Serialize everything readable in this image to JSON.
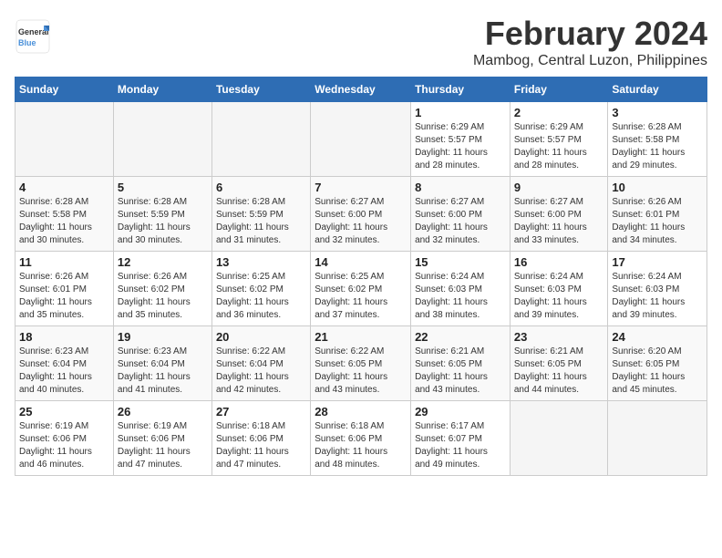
{
  "header": {
    "logo_general": "General",
    "logo_blue": "Blue",
    "month_year": "February 2024",
    "location": "Mambog, Central Luzon, Philippines"
  },
  "days_of_week": [
    "Sunday",
    "Monday",
    "Tuesday",
    "Wednesday",
    "Thursday",
    "Friday",
    "Saturday"
  ],
  "weeks": [
    [
      {
        "day": "",
        "info": ""
      },
      {
        "day": "",
        "info": ""
      },
      {
        "day": "",
        "info": ""
      },
      {
        "day": "",
        "info": ""
      },
      {
        "day": "1",
        "info": "Sunrise: 6:29 AM\nSunset: 5:57 PM\nDaylight: 11 hours\nand 28 minutes."
      },
      {
        "day": "2",
        "info": "Sunrise: 6:29 AM\nSunset: 5:57 PM\nDaylight: 11 hours\nand 28 minutes."
      },
      {
        "day": "3",
        "info": "Sunrise: 6:28 AM\nSunset: 5:58 PM\nDaylight: 11 hours\nand 29 minutes."
      }
    ],
    [
      {
        "day": "4",
        "info": "Sunrise: 6:28 AM\nSunset: 5:58 PM\nDaylight: 11 hours\nand 30 minutes."
      },
      {
        "day": "5",
        "info": "Sunrise: 6:28 AM\nSunset: 5:59 PM\nDaylight: 11 hours\nand 30 minutes."
      },
      {
        "day": "6",
        "info": "Sunrise: 6:28 AM\nSunset: 5:59 PM\nDaylight: 11 hours\nand 31 minutes."
      },
      {
        "day": "7",
        "info": "Sunrise: 6:27 AM\nSunset: 6:00 PM\nDaylight: 11 hours\nand 32 minutes."
      },
      {
        "day": "8",
        "info": "Sunrise: 6:27 AM\nSunset: 6:00 PM\nDaylight: 11 hours\nand 32 minutes."
      },
      {
        "day": "9",
        "info": "Sunrise: 6:27 AM\nSunset: 6:00 PM\nDaylight: 11 hours\nand 33 minutes."
      },
      {
        "day": "10",
        "info": "Sunrise: 6:26 AM\nSunset: 6:01 PM\nDaylight: 11 hours\nand 34 minutes."
      }
    ],
    [
      {
        "day": "11",
        "info": "Sunrise: 6:26 AM\nSunset: 6:01 PM\nDaylight: 11 hours\nand 35 minutes."
      },
      {
        "day": "12",
        "info": "Sunrise: 6:26 AM\nSunset: 6:02 PM\nDaylight: 11 hours\nand 35 minutes."
      },
      {
        "day": "13",
        "info": "Sunrise: 6:25 AM\nSunset: 6:02 PM\nDaylight: 11 hours\nand 36 minutes."
      },
      {
        "day": "14",
        "info": "Sunrise: 6:25 AM\nSunset: 6:02 PM\nDaylight: 11 hours\nand 37 minutes."
      },
      {
        "day": "15",
        "info": "Sunrise: 6:24 AM\nSunset: 6:03 PM\nDaylight: 11 hours\nand 38 minutes."
      },
      {
        "day": "16",
        "info": "Sunrise: 6:24 AM\nSunset: 6:03 PM\nDaylight: 11 hours\nand 39 minutes."
      },
      {
        "day": "17",
        "info": "Sunrise: 6:24 AM\nSunset: 6:03 PM\nDaylight: 11 hours\nand 39 minutes."
      }
    ],
    [
      {
        "day": "18",
        "info": "Sunrise: 6:23 AM\nSunset: 6:04 PM\nDaylight: 11 hours\nand 40 minutes."
      },
      {
        "day": "19",
        "info": "Sunrise: 6:23 AM\nSunset: 6:04 PM\nDaylight: 11 hours\nand 41 minutes."
      },
      {
        "day": "20",
        "info": "Sunrise: 6:22 AM\nSunset: 6:04 PM\nDaylight: 11 hours\nand 42 minutes."
      },
      {
        "day": "21",
        "info": "Sunrise: 6:22 AM\nSunset: 6:05 PM\nDaylight: 11 hours\nand 43 minutes."
      },
      {
        "day": "22",
        "info": "Sunrise: 6:21 AM\nSunset: 6:05 PM\nDaylight: 11 hours\nand 43 minutes."
      },
      {
        "day": "23",
        "info": "Sunrise: 6:21 AM\nSunset: 6:05 PM\nDaylight: 11 hours\nand 44 minutes."
      },
      {
        "day": "24",
        "info": "Sunrise: 6:20 AM\nSunset: 6:05 PM\nDaylight: 11 hours\nand 45 minutes."
      }
    ],
    [
      {
        "day": "25",
        "info": "Sunrise: 6:19 AM\nSunset: 6:06 PM\nDaylight: 11 hours\nand 46 minutes."
      },
      {
        "day": "26",
        "info": "Sunrise: 6:19 AM\nSunset: 6:06 PM\nDaylight: 11 hours\nand 47 minutes."
      },
      {
        "day": "27",
        "info": "Sunrise: 6:18 AM\nSunset: 6:06 PM\nDaylight: 11 hours\nand 47 minutes."
      },
      {
        "day": "28",
        "info": "Sunrise: 6:18 AM\nSunset: 6:06 PM\nDaylight: 11 hours\nand 48 minutes."
      },
      {
        "day": "29",
        "info": "Sunrise: 6:17 AM\nSunset: 6:07 PM\nDaylight: 11 hours\nand 49 minutes."
      },
      {
        "day": "",
        "info": ""
      },
      {
        "day": "",
        "info": ""
      }
    ]
  ]
}
